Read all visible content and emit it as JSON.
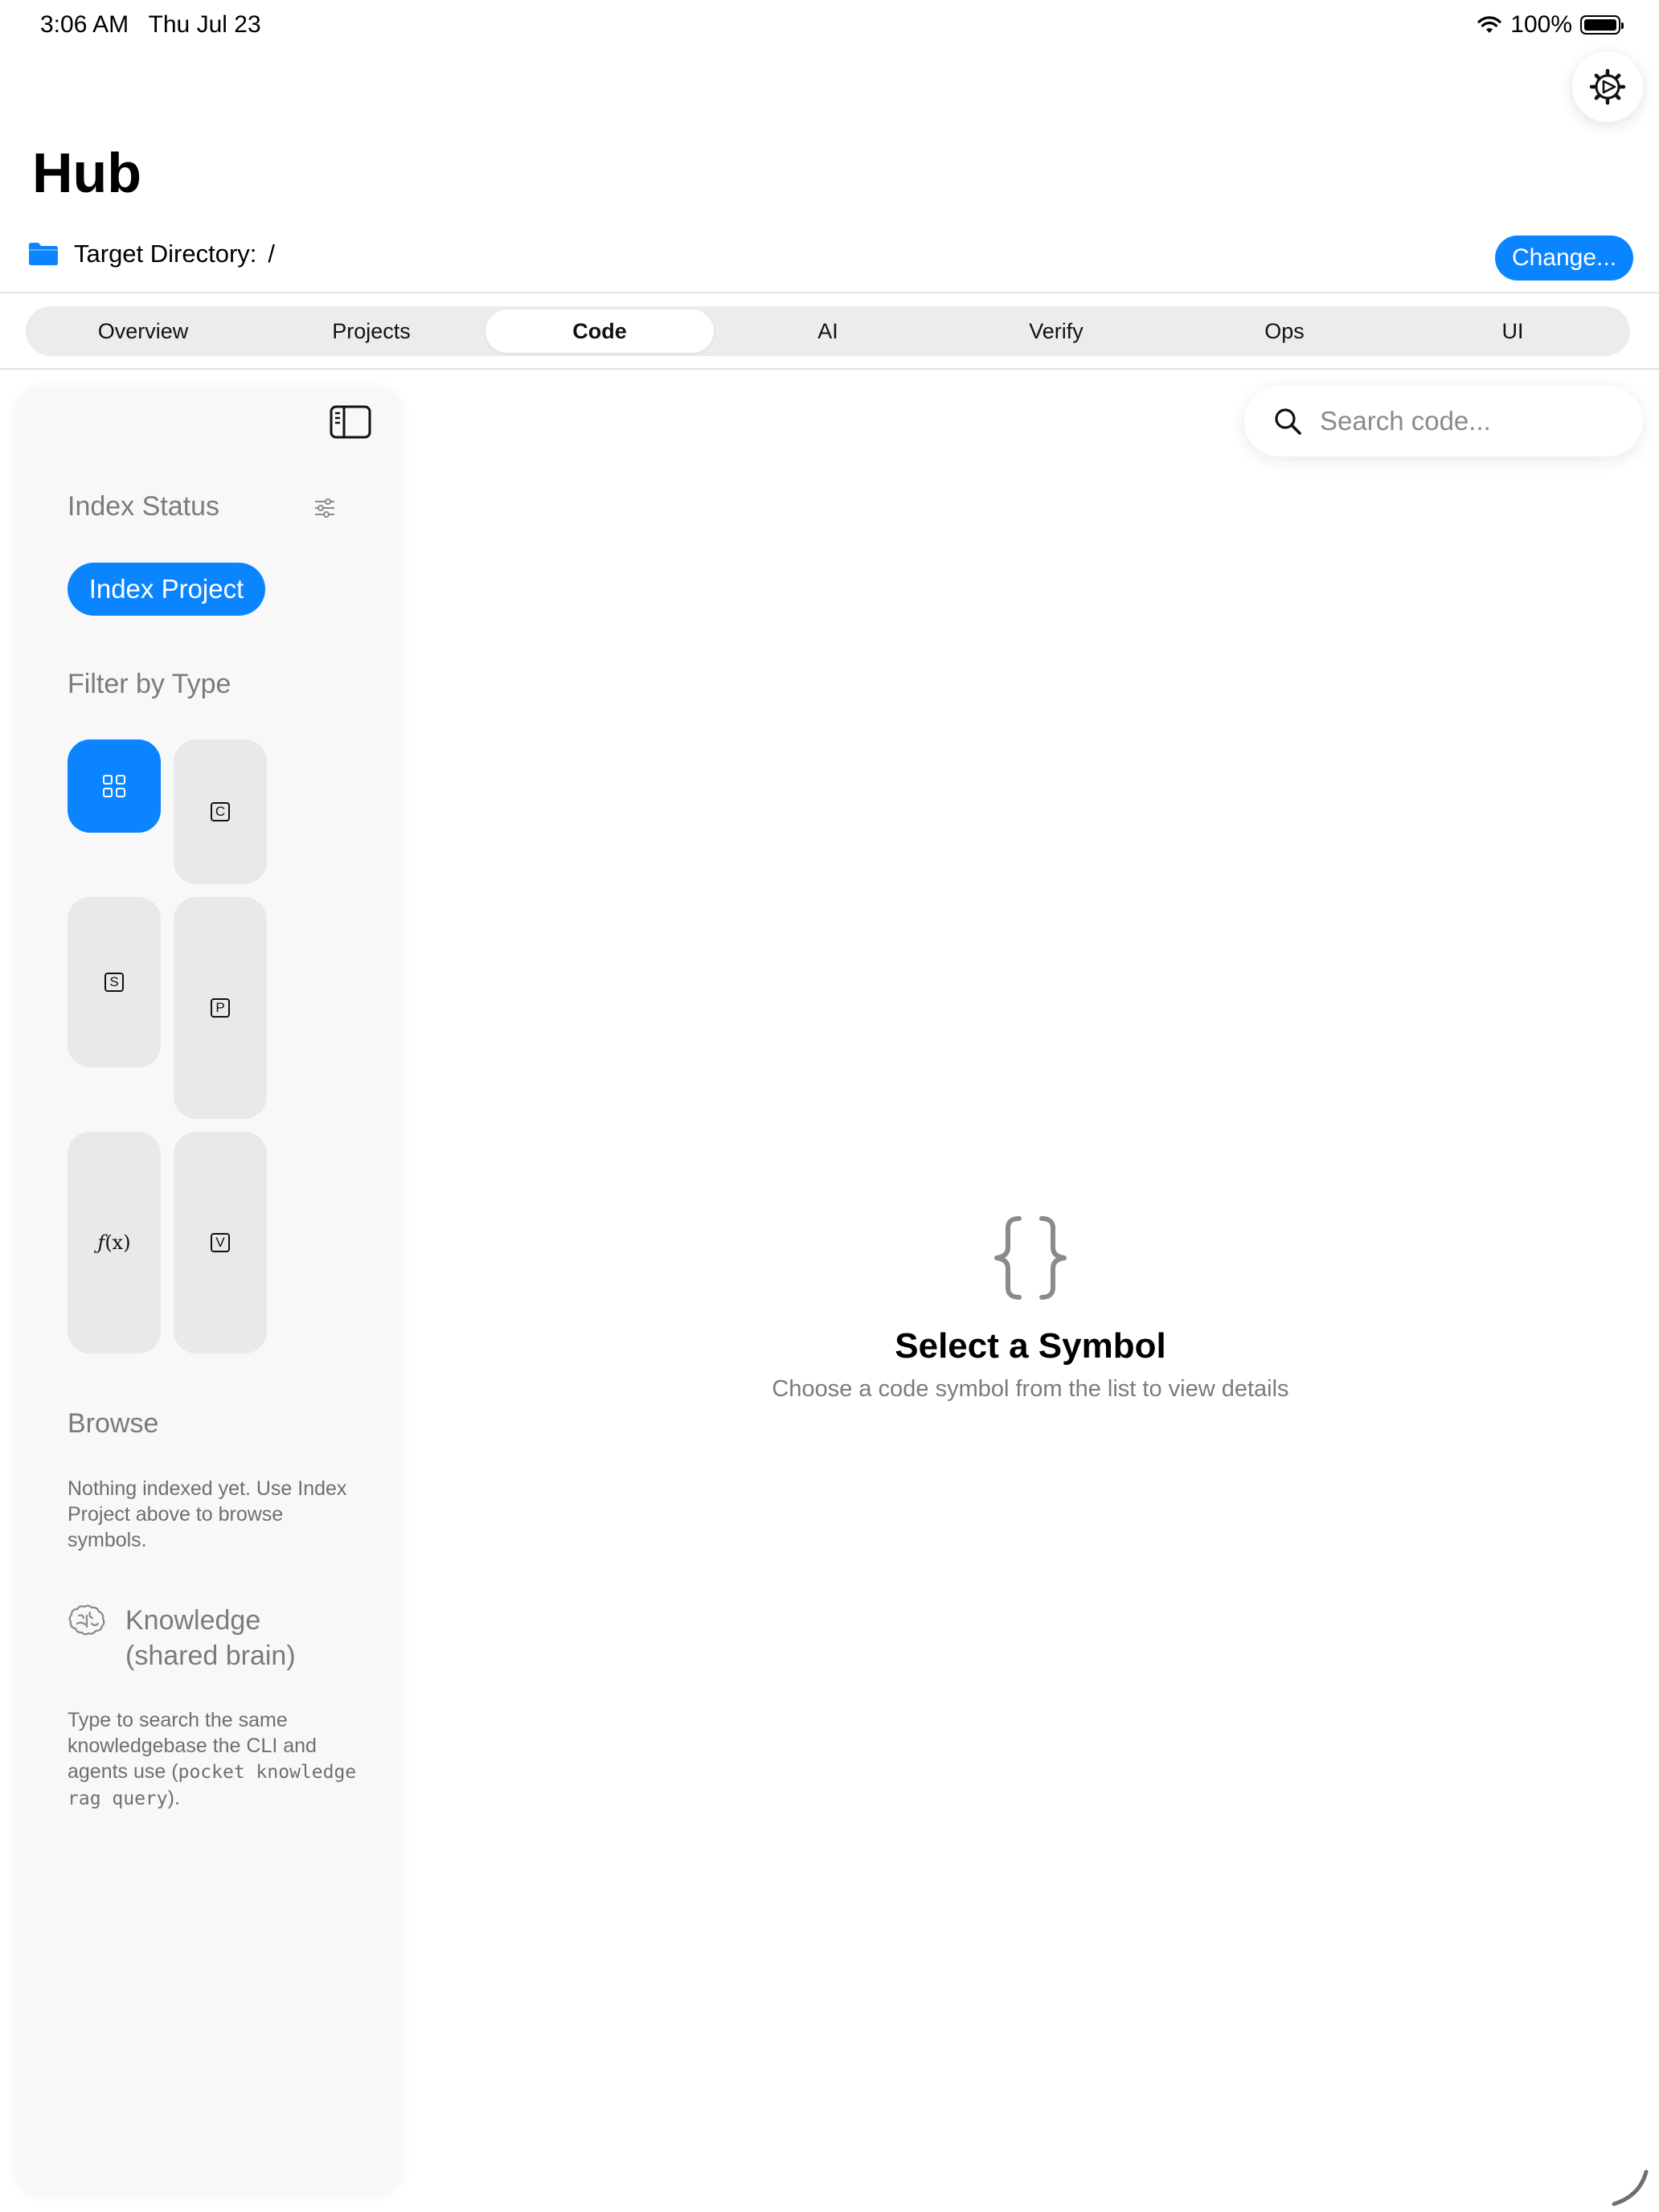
{
  "status_bar": {
    "time": "3:06 AM",
    "date": "Thu Jul 23",
    "battery": "100%",
    "icons": [
      "wifi-icon",
      "battery-icon"
    ]
  },
  "header": {
    "title": "Hub",
    "settings_icon": "gear-icon",
    "target_label": "Target Directory:",
    "target_value": "/",
    "change_button": "Change..."
  },
  "tabs": [
    {
      "label": "Overview",
      "active": false
    },
    {
      "label": "Projects",
      "active": false
    },
    {
      "label": "Code",
      "active": true
    },
    {
      "label": "AI",
      "active": false
    },
    {
      "label": "Verify",
      "active": false
    },
    {
      "label": "Ops",
      "active": false
    },
    {
      "label": "UI",
      "active": false
    }
  ],
  "sidebar": {
    "index_status_title": "Index Status",
    "index_button": "Index Project",
    "filter_title": "Filter by Type",
    "filters": [
      {
        "name": "all",
        "icon": "grid-icon",
        "active": true
      },
      {
        "name": "class",
        "letter": "C",
        "active": false
      },
      {
        "name": "struct",
        "letter": "S",
        "active": false
      },
      {
        "name": "protocol",
        "letter": "P",
        "active": false
      },
      {
        "name": "function",
        "label": "(x)",
        "active": false
      },
      {
        "name": "variable",
        "letter": "V",
        "active": false
      }
    ],
    "browse_title": "Browse",
    "browse_text": "Nothing indexed yet. Use Index Project above to browse symbols.",
    "knowledge_title_line1": "Knowledge",
    "knowledge_title_line2": "(shared brain)",
    "knowledge_text_1": "Type to search the same knowledgebase the CLI and agents use (",
    "knowledge_code": "pocket knowledge rag query",
    "knowledge_text_2": ")."
  },
  "search": {
    "placeholder": "Search code...",
    "value": ""
  },
  "empty_state": {
    "icon": "curly-braces-icon",
    "title": "Select a Symbol",
    "subtitle": "Choose a code symbol from the list to view details"
  },
  "colors": {
    "accent": "#0a84ff",
    "sidebar_bg": "#f8f8f9",
    "chip_bg": "#e9e9eb",
    "muted_text": "#7b7b7f"
  }
}
